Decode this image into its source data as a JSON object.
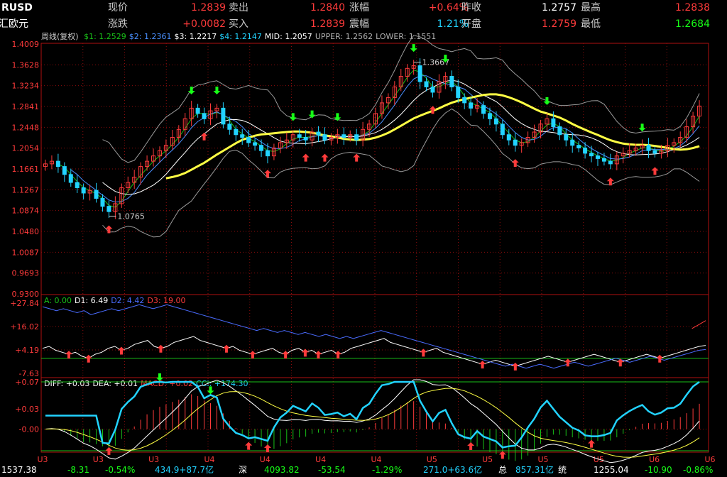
{
  "header": {
    "symbol": "RUSD",
    "name": "汇欧元",
    "row1": [
      {
        "label": "现价",
        "value": "1.2839",
        "vclass": "red"
      },
      {
        "label": "卖出",
        "value": "1.2840",
        "vclass": "red"
      },
      {
        "label": "涨幅",
        "value": "+0.64%",
        "vclass": "red"
      },
      {
        "label": "昨收",
        "value": "1.2757",
        "vclass": "wht"
      },
      {
        "label": "最高",
        "value": "1.2838",
        "vclass": "red"
      }
    ],
    "row2": [
      {
        "label": "涨跌",
        "value": "+0.0082",
        "vclass": "red"
      },
      {
        "label": "买入",
        "value": "1.2839",
        "vclass": "red"
      },
      {
        "label": "震幅",
        "value": "1.21%",
        "vclass": "cyan"
      },
      {
        "label": "开盘",
        "value": "1.2759",
        "vclass": "red"
      },
      {
        "label": "最低",
        "value": "1.2684",
        "vclass": "grn"
      }
    ]
  },
  "main_indicator": {
    "period": "周线(复权)",
    "items": [
      {
        "text": "$1: 1.2529",
        "color": "#18c018"
      },
      {
        "text": "$2: 1.2361",
        "color": "#4a90ff"
      },
      {
        "text": "$3: 1.2217",
        "color": "#ffffff"
      },
      {
        "text": "$4: 1.2147",
        "color": "#22d3ff"
      },
      {
        "text": "MID: 1.2057",
        "color": "#ffffff"
      },
      {
        "text": "UPPER: 1.2562",
        "color": "#b0b0b0"
      },
      {
        "text": "LOWER: 1.1551",
        "color": "#b0b0b0"
      }
    ]
  },
  "mid_indicator": {
    "items": [
      {
        "text": "A: 0.00",
        "color": "#18c018"
      },
      {
        "text": "D1: 6.49",
        "color": "#ffffff"
      },
      {
        "text": "D2: 4.42",
        "color": "#4a6cff"
      },
      {
        "text": "D3: 19.00",
        "color": "#ff3b3b"
      }
    ]
  },
  "macd_indicator": {
    "items": [
      {
        "text": "DIFF: +0.03",
        "color": "#ffffff"
      },
      {
        "text": "DEA: +0.01",
        "color": "#ffffff"
      },
      {
        "text": "MACD: +0.02",
        "color": "#ff3b3b"
      },
      {
        "text": "CCI: +174.30",
        "color": "#22d3ff"
      }
    ]
  },
  "footer": [
    {
      "text": "1537.38",
      "color": "#ffffff"
    },
    {
      "text": "-8.31",
      "color": "#17ff17"
    },
    {
      "text": "-0.54%",
      "color": "#17ff17"
    },
    {
      "text": "434.9+87.7亿",
      "color": "#22d3ff"
    },
    {
      "text": "深",
      "color": "#ffffff"
    },
    {
      "text": "4093.82",
      "color": "#17ff17"
    },
    {
      "text": "-53.54",
      "color": "#17ff17"
    },
    {
      "text": "-1.29%",
      "color": "#17ff17"
    },
    {
      "text": "271.0+63.6亿",
      "color": "#22d3ff"
    },
    {
      "text": "总",
      "color": "#ffffff"
    },
    {
      "text": "857.31亿",
      "color": "#22d3ff"
    },
    {
      "text": "统",
      "color": "#ffffff"
    },
    {
      "text": "1255.04",
      "color": "#ffffff"
    },
    {
      "text": "-10.90",
      "color": "#17ff17"
    },
    {
      "text": "-0.86%",
      "color": "#17ff17"
    }
  ],
  "chart_data": [
    {
      "type": "candlestick",
      "y_ticks": [
        "1.4009",
        "1.3628",
        "1.3234",
        "1.2841",
        "1.2448",
        "1.2054",
        "1.1661",
        "1.1267",
        "1.0874",
        "1.0480",
        "1.0087",
        "0.9693",
        "0.9300"
      ],
      "ylim": [
        0.93,
        1.4009
      ],
      "x_ticks": [
        "U3",
        "U3",
        "U3",
        "U4",
        "U4",
        "U4",
        "U4",
        "U5",
        "U5",
        "U5",
        "U5",
        "U6",
        "U6"
      ],
      "annotations": [
        {
          "text": "1.3667",
          "value": 1.3667,
          "kind": "high"
        },
        {
          "text": "1.0765",
          "value": 1.0765,
          "kind": "low"
        }
      ],
      "candles_close": [
        1.175,
        1.18,
        1.17,
        1.155,
        1.14,
        1.13,
        1.12,
        1.125,
        1.11,
        1.095,
        1.085,
        1.1,
        1.13,
        1.14,
        1.15,
        1.17,
        1.18,
        1.19,
        1.2,
        1.21,
        1.225,
        1.24,
        1.26,
        1.28,
        1.27,
        1.26,
        1.275,
        1.28,
        1.25,
        1.24,
        1.23,
        1.225,
        1.215,
        1.21,
        1.2,
        1.19,
        1.205,
        1.215,
        1.22,
        1.23,
        1.225,
        1.22,
        1.235,
        1.23,
        1.22,
        1.225,
        1.23,
        1.225,
        1.23,
        1.22,
        1.24,
        1.25,
        1.27,
        1.29,
        1.3,
        1.32,
        1.34,
        1.355,
        1.36,
        1.33,
        1.32,
        1.31,
        1.33,
        1.34,
        1.32,
        1.3,
        1.29,
        1.28,
        1.285,
        1.27,
        1.26,
        1.25,
        1.23,
        1.22,
        1.21,
        1.215,
        1.225,
        1.235,
        1.25,
        1.26,
        1.245,
        1.23,
        1.22,
        1.21,
        1.205,
        1.195,
        1.19,
        1.185,
        1.18,
        1.175,
        1.19,
        1.195,
        1.2,
        1.205,
        1.21,
        1.2,
        1.195,
        1.2,
        1.21,
        1.215,
        1.225,
        1.245,
        1.265,
        1.284
      ],
      "series": [
        {
          "name": "$1",
          "color": "#18c018"
        },
        {
          "name": "$2",
          "color": "#4a90ff"
        },
        {
          "name": "$3",
          "color": "#ffffff"
        },
        {
          "name": "$4",
          "color": "#22d3ff"
        },
        {
          "name": "MID",
          "color": "#ffff44"
        },
        {
          "name": "UPPER",
          "color": "#9a9a9a"
        },
        {
          "name": "LOWER",
          "color": "#9a9a9a"
        }
      ]
    },
    {
      "type": "line",
      "y_ticks": [
        "+27.84",
        "+16.02",
        "+4.19",
        "-7.63"
      ],
      "ylim": [
        -7.63,
        27.84
      ],
      "series": [
        {
          "name": "D1",
          "color": "#ffffff",
          "values": [
            5,
            6,
            4,
            3,
            2,
            3,
            1,
            0,
            2,
            3,
            5,
            6,
            4,
            5,
            7,
            8,
            9,
            6,
            5,
            6,
            8,
            9,
            10,
            11,
            9,
            8,
            7,
            6,
            5,
            6,
            4,
            3,
            2,
            3,
            4,
            5,
            3,
            2,
            4,
            5,
            3,
            4,
            2,
            3,
            4,
            2,
            3,
            5,
            6,
            7,
            8,
            9,
            10,
            8,
            7,
            6,
            5,
            4,
            3,
            4,
            5,
            3,
            2,
            1,
            0,
            -1,
            -2,
            -3,
            -2,
            -1,
            -2,
            -3,
            -4,
            -3,
            -2,
            -1,
            0,
            1,
            0,
            -1,
            -2,
            -1,
            0,
            1,
            2,
            1,
            0,
            -1,
            -2,
            -1,
            0,
            1,
            2,
            1,
            0,
            1,
            2,
            3,
            4,
            5,
            6,
            6.49
          ]
        },
        {
          "name": "D2",
          "color": "#4a6cff",
          "values": [
            26,
            25,
            24,
            25,
            24,
            23,
            24,
            22,
            23,
            24,
            25,
            24,
            25,
            26,
            27,
            26,
            25,
            26,
            27,
            26,
            25,
            24,
            23,
            22,
            21,
            20,
            19,
            18,
            17,
            16,
            15,
            14,
            15,
            14,
            13,
            14,
            13,
            12,
            13,
            12,
            11,
            12,
            11,
            10,
            11,
            10,
            11,
            12,
            13,
            14,
            13,
            12,
            11,
            10,
            9,
            8,
            7,
            6,
            5,
            4,
            3,
            2,
            1,
            0,
            -1,
            -2,
            -3,
            -4,
            -3,
            -4,
            -5,
            -4,
            -3,
            -4,
            -5,
            -4,
            -3,
            -2,
            -3,
            -4,
            -3,
            -2,
            -1,
            0,
            -1,
            -2,
            -1,
            0,
            1,
            0,
            -1,
            0,
            1,
            2,
            3,
            4,
            4.42
          ]
        },
        {
          "name": "D3",
          "color": "#ff3b3b",
          "values": [
            null,
            null,
            null,
            null,
            null,
            null,
            null,
            null,
            null,
            null,
            null,
            null,
            null,
            null,
            null,
            null,
            null,
            null,
            null,
            null,
            null,
            null,
            null,
            null,
            null,
            null,
            null,
            null,
            null,
            null,
            null,
            null,
            null,
            null,
            null,
            null,
            null,
            null,
            null,
            null,
            null,
            null,
            null,
            null,
            null,
            null,
            null,
            null,
            null,
            null,
            null,
            null,
            null,
            null,
            null,
            null,
            null,
            null,
            null,
            null,
            null,
            null,
            null,
            null,
            null,
            null,
            null,
            null,
            null,
            null,
            null,
            null,
            null,
            null,
            null,
            null,
            null,
            null,
            null,
            null,
            null,
            null,
            null,
            null,
            null,
            null,
            null,
            null,
            null,
            null,
            null,
            null,
            null,
            null,
            null,
            15,
            17,
            19
          ]
        }
      ]
    },
    {
      "type": "line",
      "y_ticks": [
        "+0.07",
        "+0.03",
        "-0.00"
      ],
      "ylim": [
        -0.03,
        0.07
      ],
      "series": [
        {
          "name": "DIFF",
          "color": "#ffffff"
        },
        {
          "name": "DEA",
          "color": "#ffff44"
        },
        {
          "name": "MACD",
          "color": "#ff3b3b"
        },
        {
          "name": "CCI",
          "color": "#22d3ff"
        }
      ]
    }
  ]
}
